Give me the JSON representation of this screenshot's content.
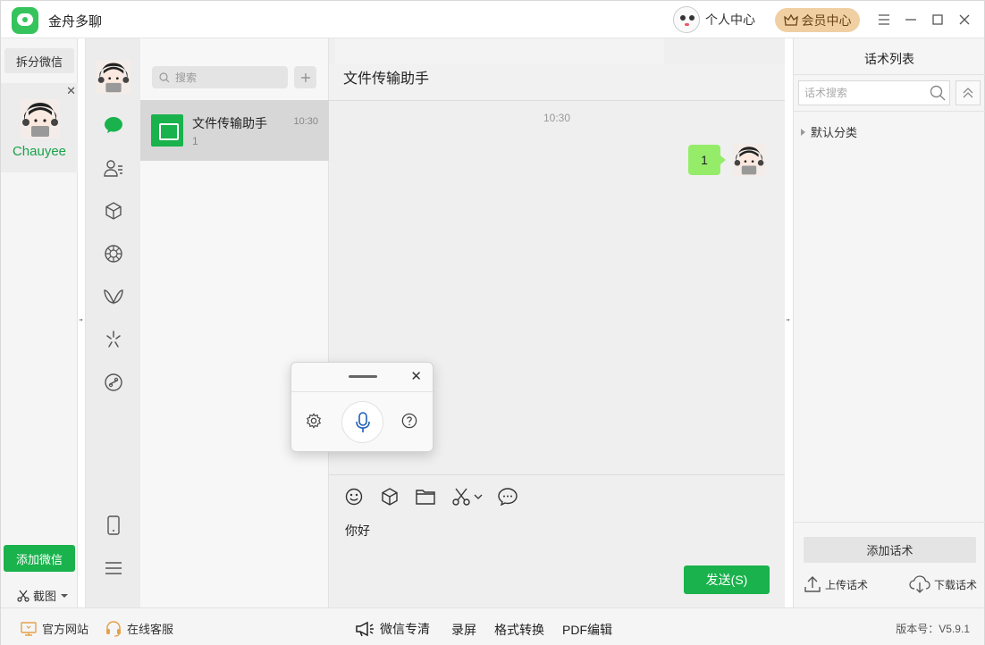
{
  "titlebar": {
    "app_name": "金舟多聊",
    "user_center": "个人中心",
    "vip_center": "会员中心"
  },
  "accounts": {
    "split_button": "拆分微信",
    "account_name": "Chauyee",
    "add_button": "添加微信",
    "screenshot_label": "截图"
  },
  "chatlist": {
    "search_placeholder": "搜索",
    "items": [
      {
        "name": "文件传输助手",
        "time": "10:30",
        "preview": "1"
      }
    ]
  },
  "conversation": {
    "title": "文件传输助手",
    "timestamp": "10:30",
    "message": "1",
    "input_text": "你好",
    "send_label": "发送(S)"
  },
  "scripts": {
    "title": "话术列表",
    "search_placeholder": "话术搜索",
    "category": "默认分类",
    "add_label": "添加话术",
    "upload_label": "上传话术",
    "download_label": "下载话术"
  },
  "statusbar": {
    "website": "官方网站",
    "support": "在线客服",
    "hd": "微信专清",
    "record": "录屏",
    "convert": "格式转换",
    "pdf": "PDF编辑",
    "version": "版本号：V5.9.1"
  },
  "colors": {
    "brand_green": "#19b24c",
    "bubble_green": "#95ec69",
    "vip_gold": "#f0cfa3"
  }
}
